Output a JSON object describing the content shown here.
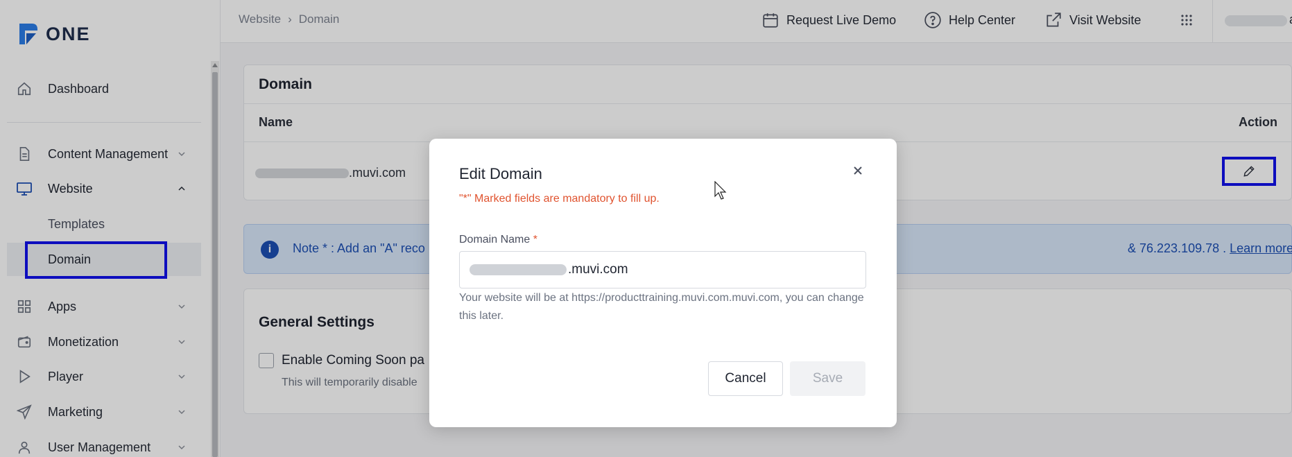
{
  "app": {
    "logo_text": "ONE"
  },
  "sidebar": {
    "items": [
      {
        "id": "dashboard",
        "label": "Dashboard",
        "icon": "home-icon"
      },
      {
        "id": "content",
        "label": "Content Management",
        "icon": "document-icon"
      },
      {
        "id": "website",
        "label": "Website",
        "icon": "monitor-icon"
      },
      {
        "id": "apps",
        "label": "Apps",
        "icon": "grid-icon"
      },
      {
        "id": "monetization",
        "label": "Monetization",
        "icon": "wallet-icon"
      },
      {
        "id": "player",
        "label": "Player",
        "icon": "play-icon"
      },
      {
        "id": "marketing",
        "label": "Marketing",
        "icon": "send-icon"
      },
      {
        "id": "users",
        "label": "User Management",
        "icon": "user-icon"
      }
    ],
    "website_subitems": [
      {
        "label": "Templates"
      },
      {
        "label": "Domain"
      }
    ]
  },
  "topbar": {
    "breadcrumb": [
      "Website",
      "Domain"
    ],
    "breadcrumb_sep": "›",
    "request_demo": "Request Live Demo",
    "help_center": "Help Center",
    "visit_website": "Visit Website",
    "user_initial": "a"
  },
  "domain_card": {
    "title": "Domain",
    "col_name": "Name",
    "col_action": "Action",
    "row_domain_suffix": ".muvi.com"
  },
  "note": {
    "prefix": "Note * : Add an \"A\" reco",
    "suffix": "& 76.223.109.78 .",
    "link": "Learn more"
  },
  "general_settings": {
    "title": "General Settings",
    "coming_soon_label": "Enable Coming Soon pa",
    "coming_soon_help": "This will temporarily disable"
  },
  "modal": {
    "title": "Edit Domain",
    "close_icon": "close-icon",
    "mandatory_hint": "\"*\" Marked fields are mandatory to fill up.",
    "field_label": "Domain Name",
    "required_mark": "*",
    "field_value_suffix": ".muvi.com",
    "help_text": "Your website will be at https://producttraining.muvi.com.muvi.com, you can change this later.",
    "cancel_label": "Cancel",
    "save_label": "Save"
  },
  "colors": {
    "accent": "#1c4fb5",
    "highlight": "#1111ee",
    "required": "#e0532f"
  }
}
